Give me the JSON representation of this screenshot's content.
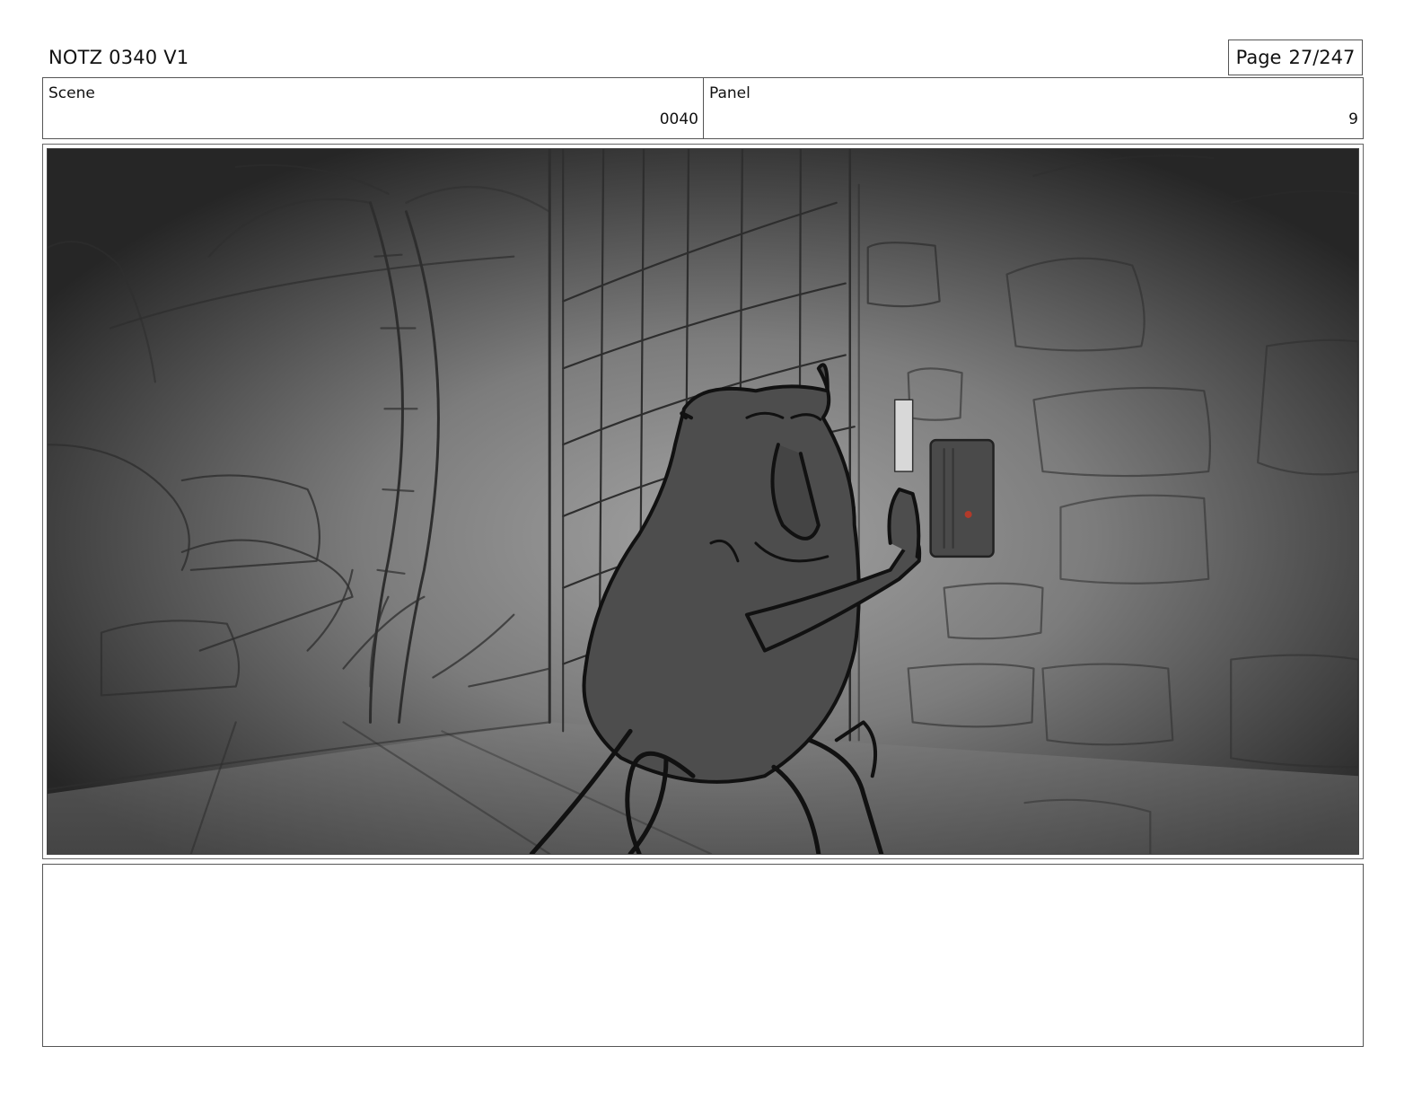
{
  "header": {
    "title": "NOTZ 0340 V1",
    "page_label": "Page",
    "page_number": "27/247"
  },
  "info": {
    "scene_label": "Scene",
    "scene_value": "0040",
    "panel_label": "Panel",
    "panel_value": "9"
  },
  "notes": {
    "text": ""
  }
}
